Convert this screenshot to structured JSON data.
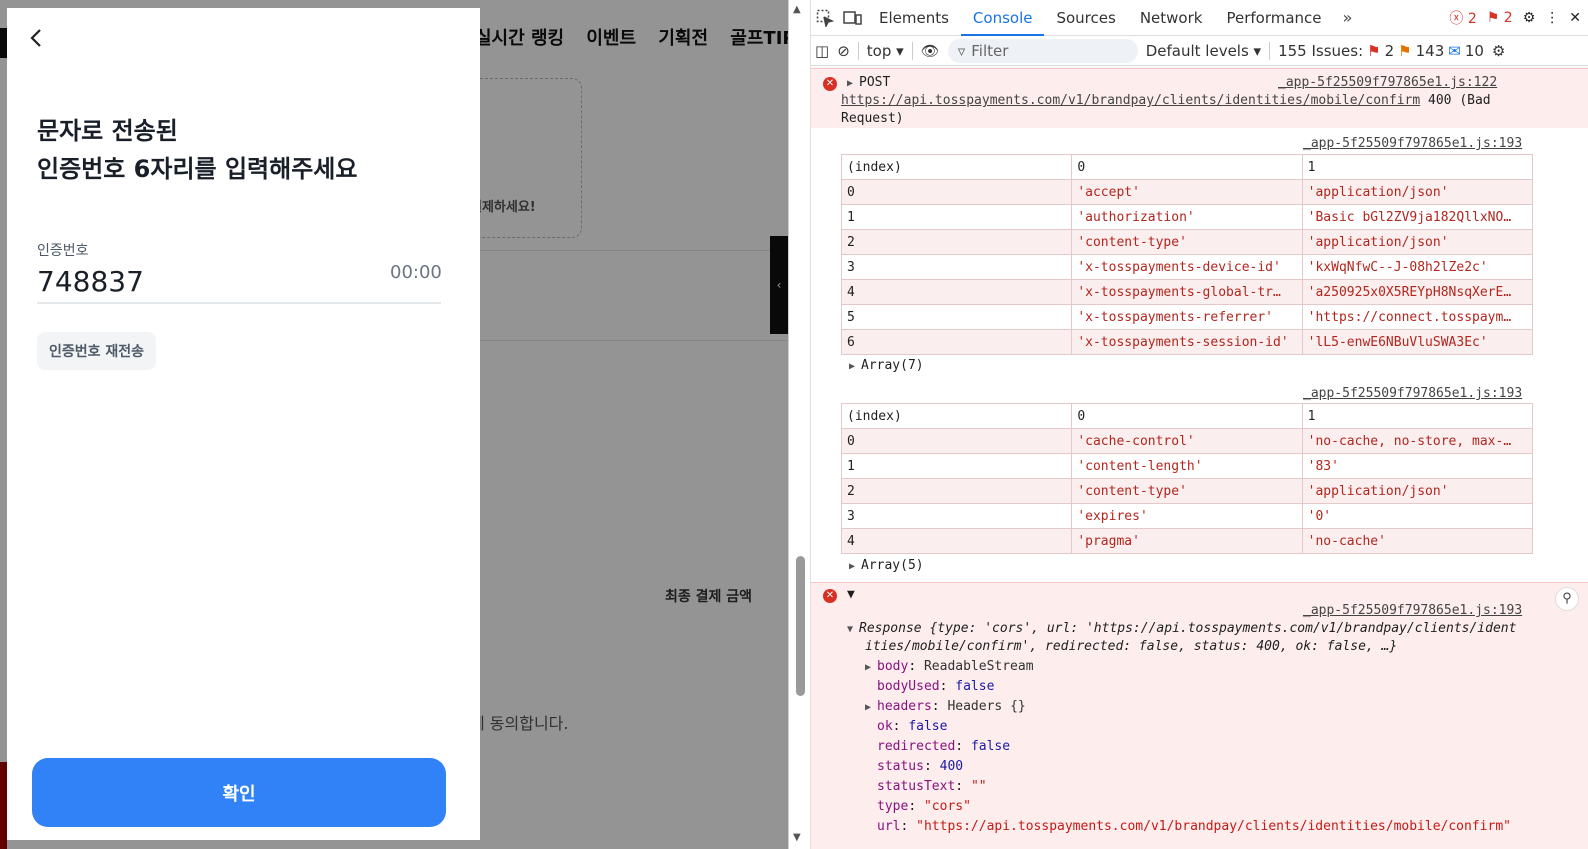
{
  "background_page": {
    "nav": [
      "실시간 랭킹",
      "이벤트",
      "기획전",
      "골프TIP"
    ],
    "dash_text": "결제하세요!",
    "final_amount_label": "최종 결제 금액",
    "agree_text": "에 동의합니다."
  },
  "modal": {
    "title_line1": "문자로 전송된",
    "title_line2": "인증번호 6자리를 입력해주세요",
    "code_label": "인증번호",
    "code_value": "748837",
    "timer": "00:00",
    "resend_label": "인증번호 재전송",
    "confirm_label": "확인"
  },
  "devtools": {
    "tabs": [
      "Elements",
      "Console",
      "Sources",
      "Network",
      "Performance"
    ],
    "active_tab": "Console",
    "error_count": "2",
    "warning_count": "2",
    "toolbar": {
      "context": "top",
      "filter_placeholder": "Filter",
      "levels": "Default levels",
      "issues_label": "155 Issues:",
      "issues_err": "2",
      "issues_warn": "143",
      "issues_info": "10"
    },
    "console": {
      "msg1": {
        "method": "POST",
        "url": "https://api.tosspayments.com/v1/brandpay/clients/identities/mobile/confirm",
        "status": "400 (Bad",
        "status2": "Request)",
        "source": "_app-5f25509f797865e1.js:122"
      },
      "table1": {
        "source": "_app-5f25509f797865e1.js:193",
        "headers": [
          "(index)",
          "0",
          "1"
        ],
        "rows": [
          [
            "0",
            "'accept'",
            "'application/json'"
          ],
          [
            "1",
            "'authorization'",
            "'Basic bGl2ZV9ja182QllxNO…"
          ],
          [
            "2",
            "'content-type'",
            "'application/json'"
          ],
          [
            "3",
            "'x-tosspayments-device-id'",
            "'kxWqNfwC--J-08h2lZe2c'"
          ],
          [
            "4",
            "'x-tosspayments-global-tr…",
            "'a250925x0X5REYpH8NsqXerE…"
          ],
          [
            "5",
            "'x-tosspayments-referrer'",
            "'https://connect.tosspaym…"
          ],
          [
            "6",
            "'x-tosspayments-session-id'",
            "'lL5-enwE6NBuVluSWA3Ec'"
          ]
        ],
        "footer": "Array(7)"
      },
      "table2": {
        "source": "_app-5f25509f797865e1.js:193",
        "headers": [
          "(index)",
          "0",
          "1"
        ],
        "rows": [
          [
            "0",
            "'cache-control'",
            "'no-cache, no-store, max-…"
          ],
          [
            "1",
            "'content-length'",
            "'83'"
          ],
          [
            "2",
            "'content-type'",
            "'application/json'"
          ],
          [
            "3",
            "'expires'",
            "'0'"
          ],
          [
            "4",
            "'pragma'",
            "'no-cache'"
          ]
        ],
        "footer": "Array(5)"
      },
      "response": {
        "source": "_app-5f25509f797865e1.js:193",
        "summary_a": "Response {type: 'cors', url: 'https://api.tosspayments.com/v1/brandpay/clients/ident",
        "summary_b": "ities/mobile/confirm', redirected: false, status: 400, ok: false, …}",
        "props": [
          {
            "key": "body",
            "value": "ReadableStream",
            "kind": "plain",
            "expandable": true
          },
          {
            "key": "bodyUsed",
            "value": "false",
            "kind": "bool",
            "expandable": false
          },
          {
            "key": "headers",
            "value": "Headers {}",
            "kind": "plain",
            "expandable": true
          },
          {
            "key": "ok",
            "value": "false",
            "kind": "bool",
            "expandable": false
          },
          {
            "key": "redirected",
            "value": "false",
            "kind": "bool",
            "expandable": false
          },
          {
            "key": "status",
            "value": "400",
            "kind": "num",
            "expandable": false
          },
          {
            "key": "statusText",
            "value": "\"\"",
            "kind": "str",
            "expandable": false
          },
          {
            "key": "type",
            "value": "\"cors\"",
            "kind": "str",
            "expandable": false
          },
          {
            "key": "url",
            "value": "\"https://api.tosspayments.com/v1/brandpay/clients/identities/mobile/confirm\"",
            "kind": "str",
            "expandable": false
          }
        ]
      }
    }
  }
}
